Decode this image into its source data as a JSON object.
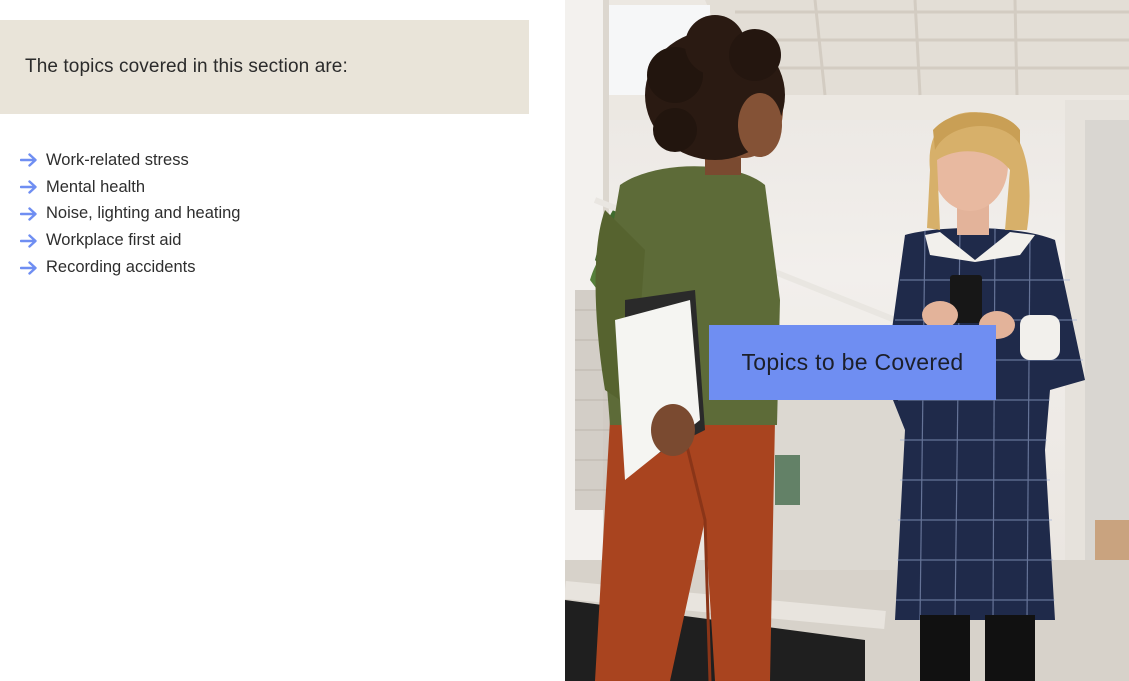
{
  "intro": {
    "text": "The topics covered in this section are:"
  },
  "topics": [
    {
      "label": "Work-related stress",
      "icon": "arrow-right-icon"
    },
    {
      "label": "Mental health",
      "icon": "arrow-right-icon"
    },
    {
      "label": "Noise, lighting and heating",
      "icon": "arrow-right-icon"
    },
    {
      "label": "Workplace first aid",
      "icon": "arrow-right-icon"
    },
    {
      "label": "Recording accidents",
      "icon": "arrow-right-icon"
    }
  ],
  "caption": {
    "title": "Topics to be Covered"
  },
  "colors": {
    "intro_bg": "#e9e4d9",
    "arrow": "#6f8ef2",
    "caption_bg": "#6f8ef2",
    "text": "#2e2e2e"
  }
}
